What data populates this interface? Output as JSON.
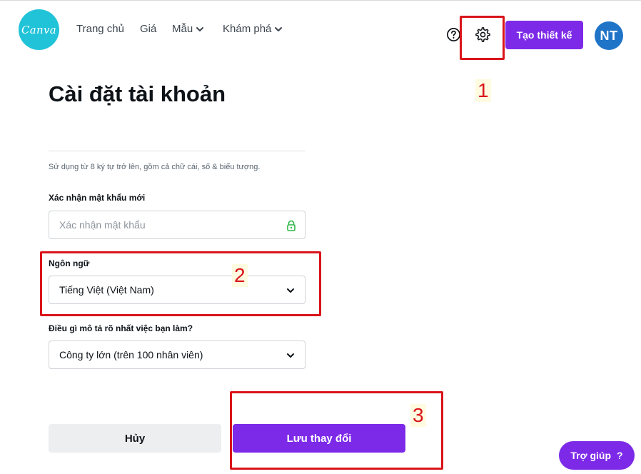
{
  "header": {
    "logo_text": "Canva",
    "nav": [
      {
        "label": "Trang chủ",
        "has_dropdown": false
      },
      {
        "label": "Giá",
        "has_dropdown": false
      },
      {
        "label": "Mẫu",
        "has_dropdown": true
      },
      {
        "label": "Khám phá",
        "has_dropdown": true
      }
    ],
    "help_icon": "question-circle-icon",
    "settings_icon": "gear-icon",
    "create_button": "Tạo thiết kế",
    "avatar_initials": "NT"
  },
  "page": {
    "title": "Cài đặt tài khoản",
    "password_hint": "Sử dụng từ 8 ký tự trở lên, gồm cả chữ cái, số & biểu tượng.",
    "confirm_password": {
      "label": "Xác nhận mật khẩu mới",
      "placeholder": "Xác nhận mật khẩu",
      "value": ""
    },
    "language": {
      "label": "Ngôn ngữ",
      "selected": "Tiếng Việt (Việt Nam)"
    },
    "occupation": {
      "label": "Điều gì mô tả rõ nhất việc bạn làm?",
      "selected": "Công ty lớn (trên 100 nhân viên)"
    },
    "cancel_button": "Hủy",
    "save_button": "Lưu thay đổi"
  },
  "help_button": {
    "label": "Trợ giúp",
    "icon": "?"
  },
  "annotations": [
    "1",
    "2",
    "3"
  ],
  "colors": {
    "brand_purple": "#7d2ae8",
    "logo_teal": "#21c3d8",
    "avatar_blue": "#1f74c8",
    "annotation_red": "#d9141a",
    "lock_green": "#2fb84a"
  }
}
